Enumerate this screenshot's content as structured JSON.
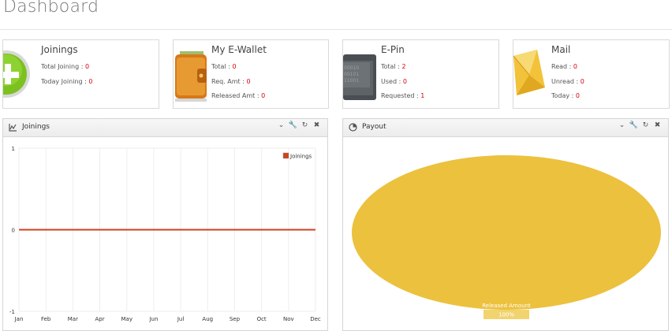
{
  "page": {
    "title": "Dashboard"
  },
  "cards": [
    {
      "title": "Joinings",
      "icon": "plus-circle-icon",
      "rows": [
        {
          "label": "Total Joining : ",
          "value": "0"
        },
        {
          "label": "Today Joining : ",
          "value": "0"
        }
      ]
    },
    {
      "title": "My E-Wallet",
      "icon": "wallet-icon",
      "rows": [
        {
          "label": "Total : ",
          "value": "0"
        },
        {
          "label": "Req. Amt : ",
          "value": "0"
        },
        {
          "label": "Released Amt : ",
          "value": "0"
        }
      ]
    },
    {
      "title": "E-Pin",
      "icon": "binary-wallet-icon",
      "rows": [
        {
          "label": "Total : ",
          "value": "2"
        },
        {
          "label": "Used : ",
          "value": "0"
        },
        {
          "label": "Requested : ",
          "value": "1"
        }
      ]
    },
    {
      "title": "Mail",
      "icon": "envelope-icon",
      "rows": [
        {
          "label": "Read : ",
          "value": "0"
        },
        {
          "label": "Unread : ",
          "value": "0"
        },
        {
          "label": "Today : ",
          "value": "0"
        }
      ]
    }
  ],
  "joinings_panel": {
    "title": "Joinings",
    "icon": "line-chart-icon",
    "tools": [
      "chevron-down-icon",
      "wrench-icon",
      "refresh-icon",
      "close-icon"
    ]
  },
  "payout_panel": {
    "title": "Payout",
    "icon": "pie-chart-icon",
    "tools": [
      "chevron-down-icon",
      "wrench-icon",
      "refresh-icon",
      "close-icon"
    ]
  },
  "chart_data": [
    {
      "type": "line",
      "title": "",
      "xlabel": "",
      "ylabel": "",
      "x": [
        "Jan",
        "Feb",
        "Mar",
        "Apr",
        "May",
        "Jun",
        "Jul",
        "Aug",
        "Sep",
        "Oct",
        "Nov",
        "Dec"
      ],
      "series": [
        {
          "name": "Joinings",
          "values": [
            0,
            0,
            0,
            0,
            0,
            0,
            0,
            0,
            0,
            0,
            0,
            0
          ],
          "color": "#d0411e"
        }
      ],
      "ylim": [
        -1,
        1
      ],
      "yticks": [
        "1",
        "0",
        "-1"
      ],
      "grid": true,
      "legend": "top-right"
    },
    {
      "type": "pie",
      "slices": [
        {
          "label": "Released Amount",
          "value": 100,
          "percent_label": "100%",
          "color": "#ecc13d"
        }
      ]
    }
  ],
  "colors": {
    "accent_value": "#d9000d",
    "pie": "#ecc13d",
    "line": "#d0411e"
  }
}
